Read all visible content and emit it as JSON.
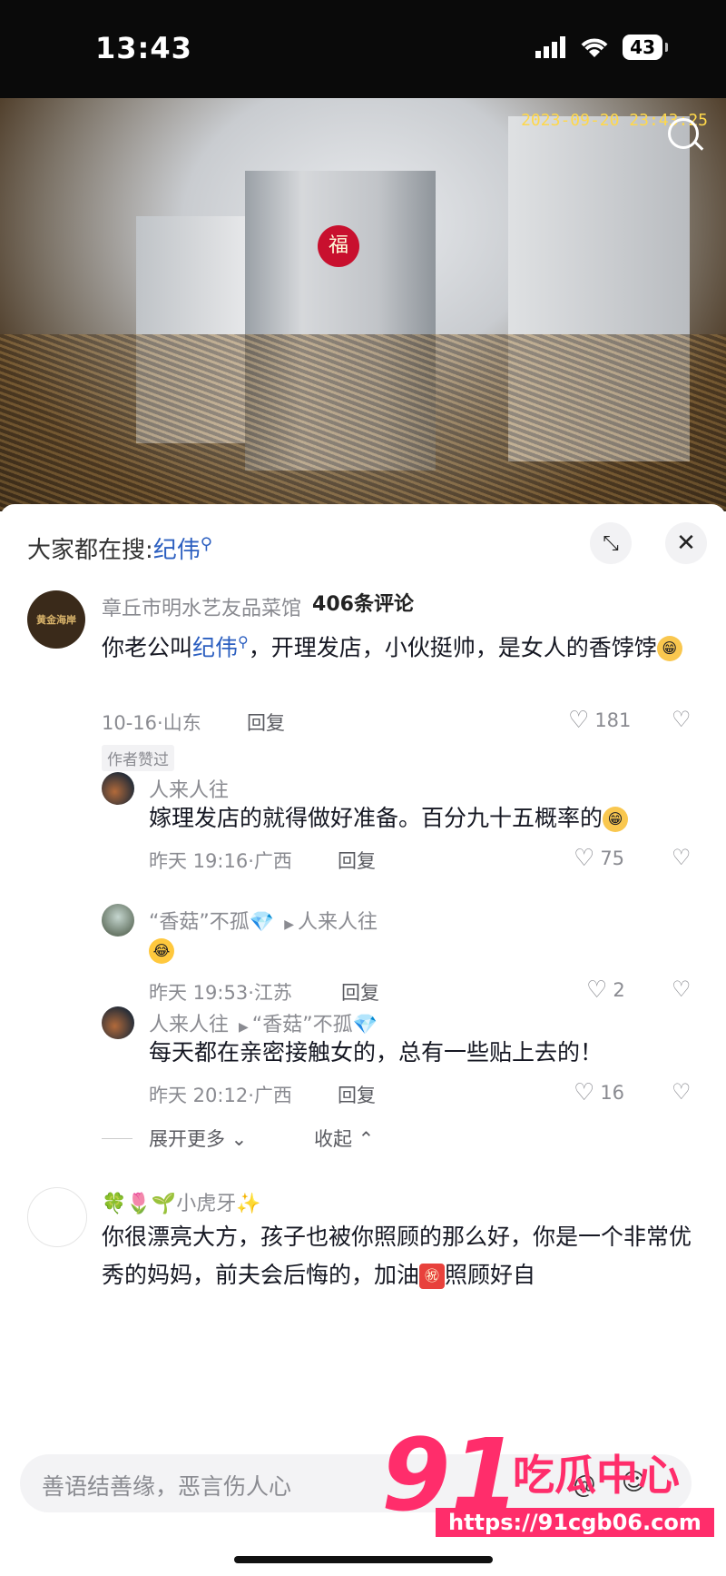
{
  "status_bar": {
    "time": "13:43",
    "battery": "43"
  },
  "video": {
    "timestamp": "2023-09-20 23:43:25"
  },
  "sheet": {
    "hot_search_prefix": "大家都在搜:",
    "hot_search_keyword": "纪伟",
    "comment_count": "406条评论"
  },
  "comments": [
    {
      "author": "章丘市明水艺友品菜馆",
      "text_before": "你老公叫",
      "text_link": "纪伟",
      "text_after": "，开理发店，小伙挺帅，是女人的香饽饽",
      "meta": "10-16·山东",
      "reply": "回复",
      "likes": "181",
      "badge": "作者赞过"
    }
  ],
  "replies": [
    {
      "author": "人来人往",
      "to": "",
      "text": "嫁理发店的就得做好准备。百分九十五概率的",
      "meta": "昨天 19:16·广西",
      "reply": "回复",
      "likes": "75"
    },
    {
      "author": "“香菇”不孤",
      "to": "人来人往",
      "text": "",
      "meta": "昨天 19:53·江苏",
      "reply": "回复",
      "likes": "2"
    },
    {
      "author": "人来人往",
      "to": "“香菇”不孤",
      "text": "每天都在亲密接触女的，总有一些贴上去的！",
      "meta": "昨天 20:12·广西",
      "reply": "回复",
      "likes": "16"
    }
  ],
  "thread_controls": {
    "expand": "展开更多",
    "collapse": "收起"
  },
  "comment2": {
    "author": "小虎牙",
    "text": "你很漂亮大方，孩子也被你照顾的那么好，你是一个非常优秀的妈妈，前夫会后悔的，加油",
    "text_tail": "照顾好自"
  },
  "input": {
    "placeholder": "善语结善缘，恶言伤人心"
  },
  "watermark": {
    "number": "91",
    "name": "吃瓜中心",
    "url": "https://91cgb06.com"
  },
  "avatar_labels": {
    "c1": "黄金海岸"
  }
}
